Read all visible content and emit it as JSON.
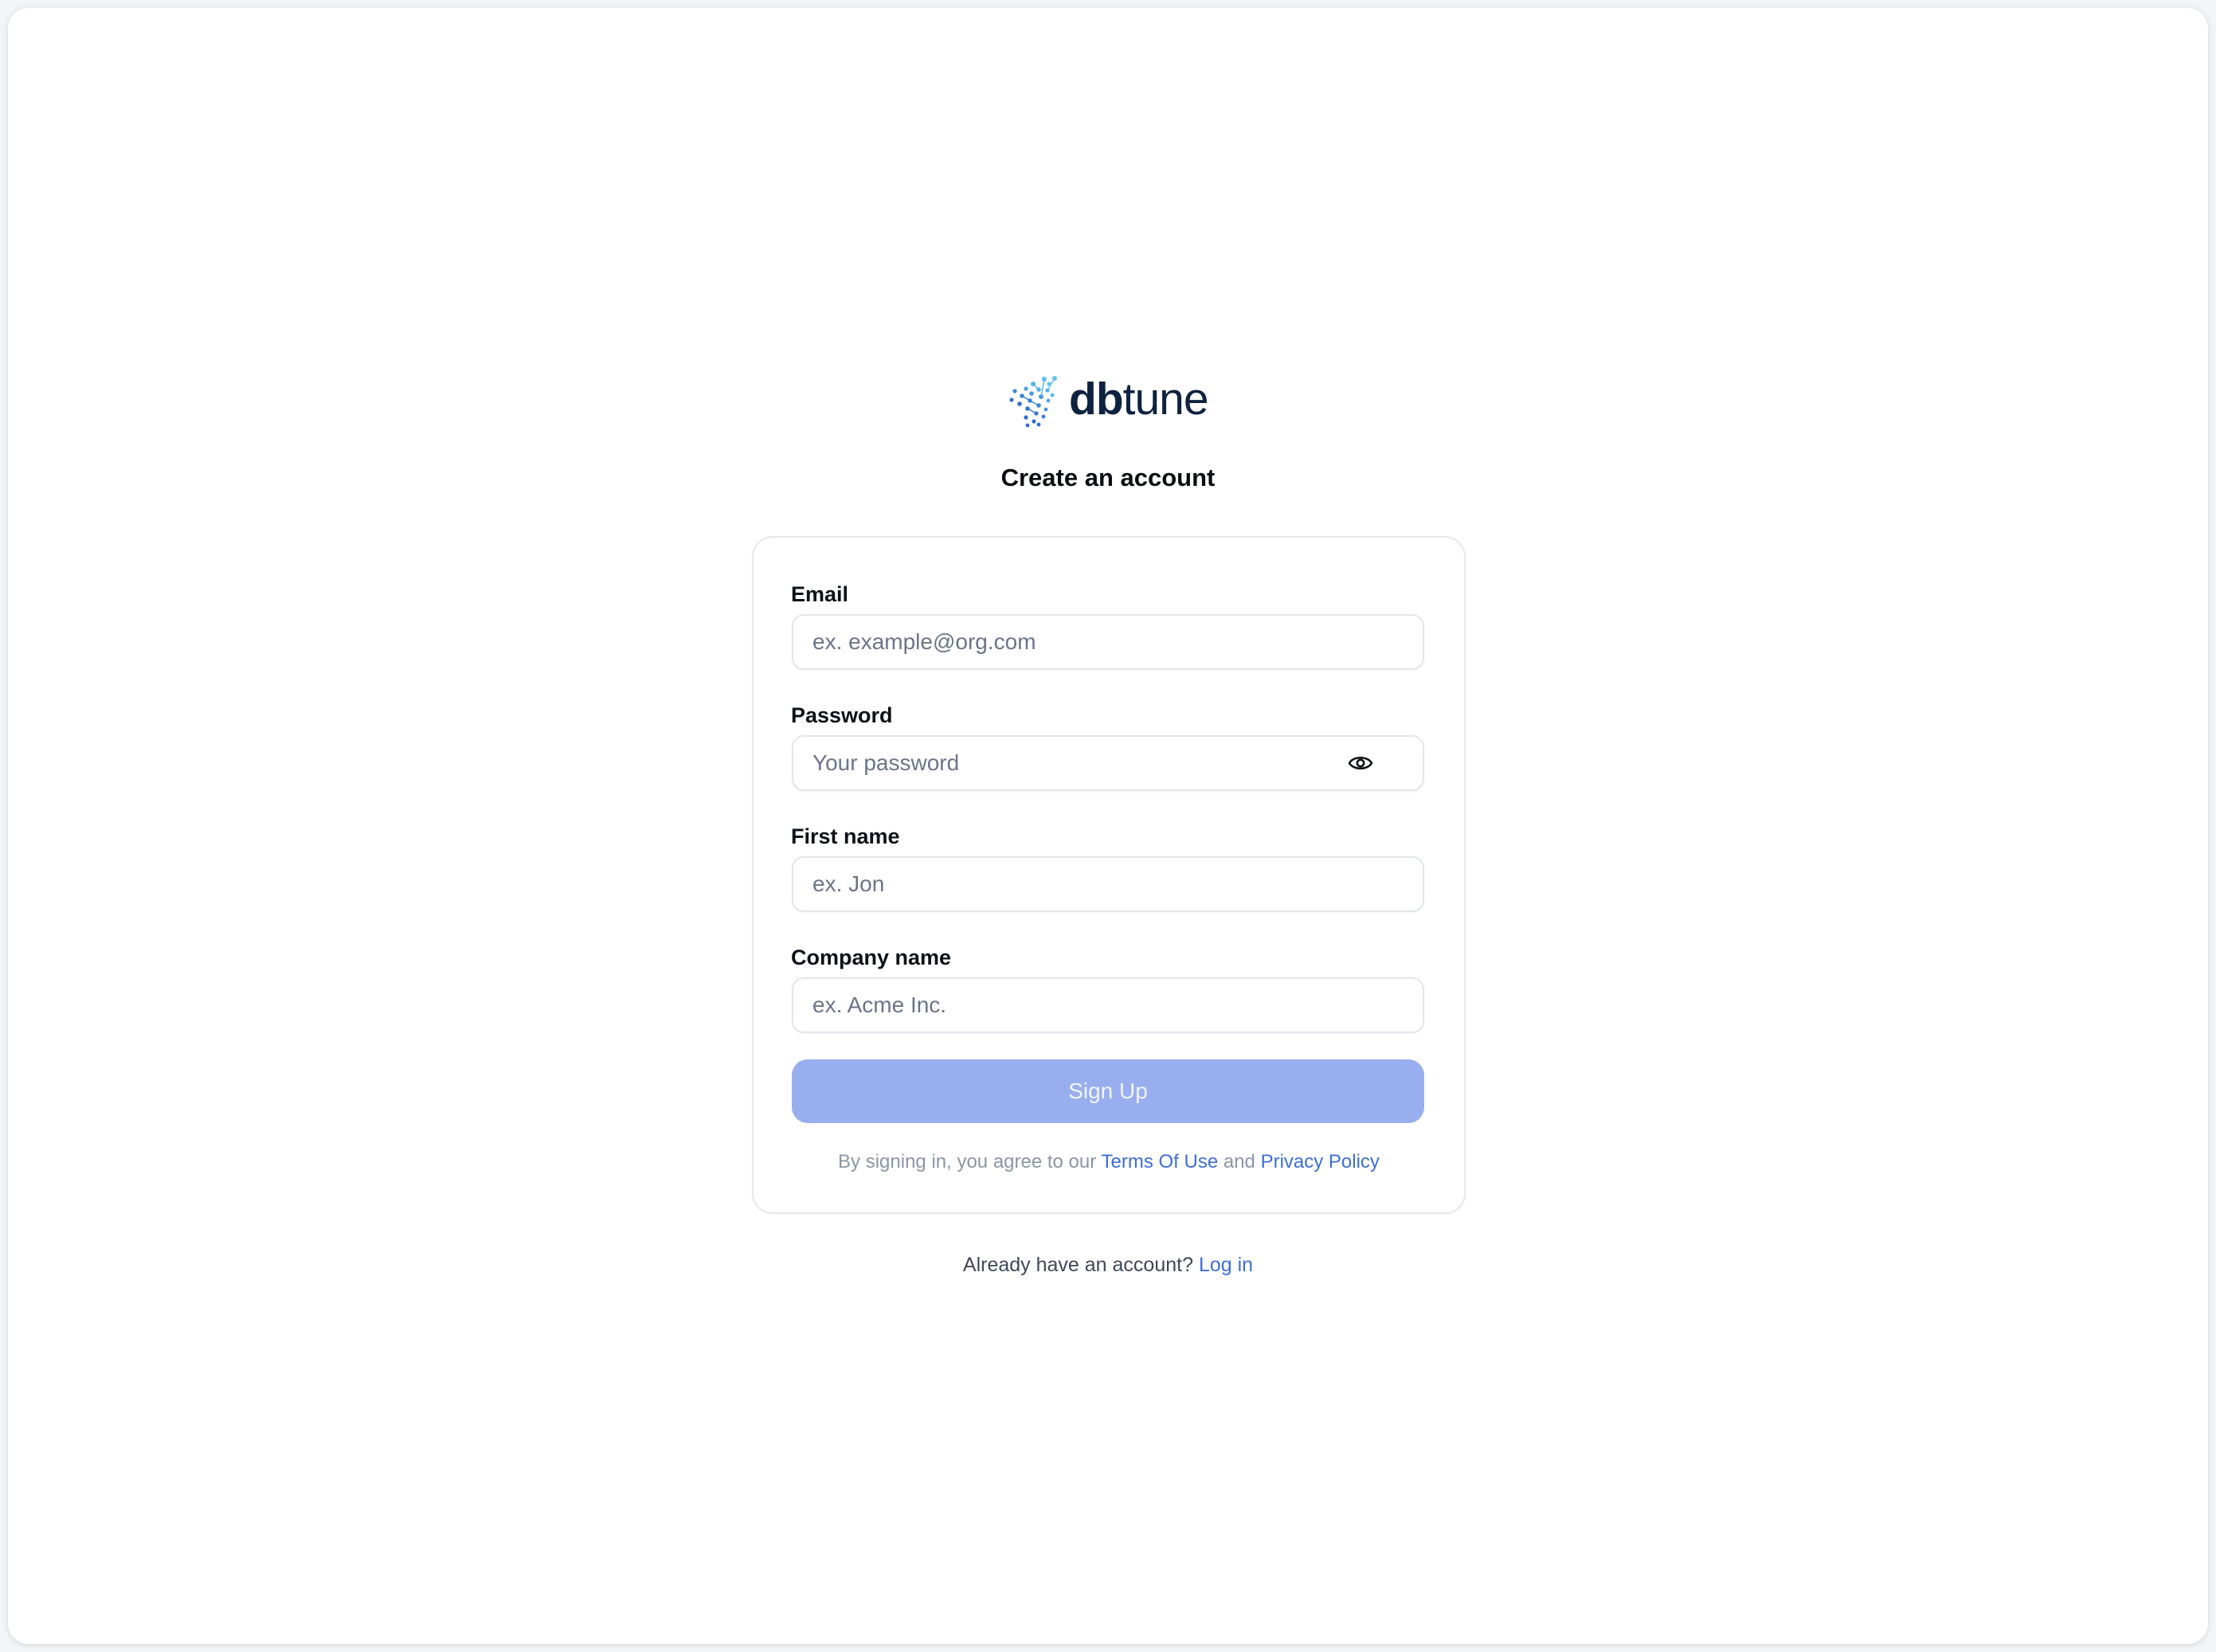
{
  "brand": {
    "name_bold": "db",
    "name_light": "tune",
    "logo_icon": "dbtune-dots-logo-icon",
    "colors": {
      "wordmark": "#0f2341",
      "dots_dark": "#2f6cd0",
      "dots_light": "#5ec6ef"
    }
  },
  "page": {
    "title": "Create an account"
  },
  "form": {
    "fields": [
      {
        "label": "Email",
        "placeholder": "ex. example@org.com",
        "value": "",
        "type": "email"
      },
      {
        "label": "Password",
        "placeholder": "Your password",
        "value": "",
        "type": "password",
        "icon": "eye-icon"
      },
      {
        "label": "First name",
        "placeholder": "ex. Jon",
        "value": "",
        "type": "text"
      },
      {
        "label": "Company name",
        "placeholder": "ex. Acme Inc.",
        "value": "",
        "type": "text"
      }
    ],
    "submit_label": "Sign Up",
    "submit_color": "#99aeee",
    "terms": {
      "prefix": "By signing in, you agree to our ",
      "terms_link": "Terms Of Use",
      "conjunction": " and ",
      "privacy_link": "Privacy Policy"
    }
  },
  "footer": {
    "prompt": "Already have an account? ",
    "login_link": "Log in",
    "link_color": "#3d6fd6"
  }
}
